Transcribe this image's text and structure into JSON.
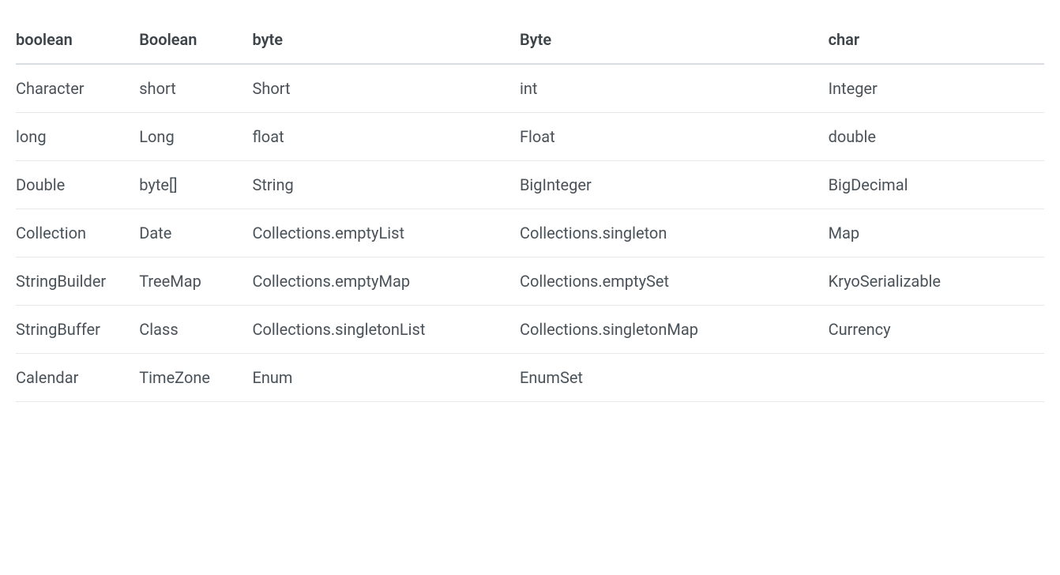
{
  "table": {
    "headers": [
      "boolean",
      "Boolean",
      "byte",
      "Byte",
      "char"
    ],
    "rows": [
      [
        "Character",
        "short",
        "Short",
        "int",
        "Integer"
      ],
      [
        "long",
        "Long",
        "float",
        "Float",
        "double"
      ],
      [
        "Double",
        "byte[]",
        "String",
        "BigInteger",
        "BigDecimal"
      ],
      [
        "Collection",
        "Date",
        "Collections.emptyList",
        "Collections.singleton",
        "Map"
      ],
      [
        "StringBuilder",
        "TreeMap",
        "Collections.emptyMap",
        "Collections.emptySet",
        "KryoSerializable"
      ],
      [
        "StringBuffer",
        "Class",
        "Collections.singletonList",
        "Collections.singletonMap",
        "Currency"
      ],
      [
        "Calendar",
        "TimeZone",
        "Enum",
        "EnumSet",
        ""
      ]
    ]
  }
}
